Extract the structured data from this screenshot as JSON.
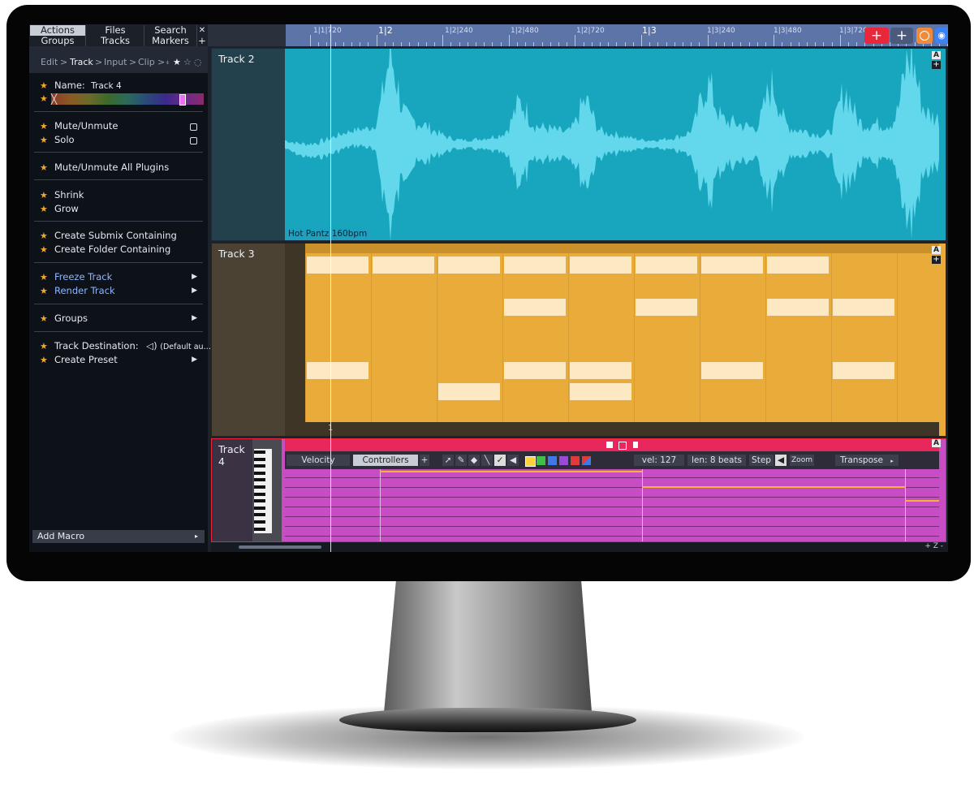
{
  "tabs": {
    "actions": "Actions",
    "files": "Files",
    "search": "Search",
    "groups": "Groups",
    "tracks": "Tracks",
    "markers": "Markers",
    "close": "✕",
    "add": "+"
  },
  "breadcrumb": {
    "edit": "Edit",
    "track": "Track",
    "input": "Input",
    "clip": "Clip",
    "sep": ">"
  },
  "menu": {
    "name_label": "Name:",
    "name_value": "Track 4",
    "mute": "Mute/Unmute",
    "solo": "Solo",
    "mute_plugins": "Mute/Unmute All Plugins",
    "shrink": "Shrink",
    "grow": "Grow",
    "create_submix": "Create Submix Containing",
    "create_folder": "Create Folder Containing",
    "freeze": "Freeze Track",
    "render": "Render Track",
    "groups": "Groups",
    "destination_label": "Track Destination:",
    "destination_value": "(Default au…",
    "create_preset": "Create Preset",
    "add_macro": "Add Macro"
  },
  "ruler": {
    "labels": [
      "1|1|720",
      "1|2",
      "1|2|240",
      "1|2|480",
      "1|2|720",
      "1|3",
      "1|3|240",
      "1|3|480",
      "1|3|720"
    ]
  },
  "tracks": {
    "track2": {
      "name": "Track 2",
      "clip_label": "Hot Pantz 160bpm",
      "color": "#17a6bd"
    },
    "track3": {
      "name": "Track 3",
      "bar_number": "1",
      "color": "#e9ab3a"
    },
    "track4": {
      "name": "Track 4",
      "color": "#c84cc4"
    }
  },
  "midi_toolbar": {
    "velocity": "Velocity",
    "controllers": "Controllers",
    "plus": "+",
    "vel": "vel: 127",
    "len": "len: 8 beats",
    "step": "Step",
    "zoom": "Zoom",
    "transpose": "Transpose"
  },
  "clip_badge": "A",
  "footer_controls": "+ Z -",
  "colors": {
    "accent_red": "#e8283a",
    "star": "#f0a82a",
    "ruler": "#5c74a8",
    "playhead": "#ffffff"
  },
  "icons": [
    "close-icon",
    "plus-icon",
    "star-icon",
    "checkbox-icon",
    "chevron-right-icon",
    "speaker-icon",
    "eye-icon",
    "record-icon",
    "piano-keys-icon",
    "pointer-icon",
    "pencil-icon",
    "eraser-icon",
    "line-icon",
    "brush-icon",
    "volume-icon"
  ]
}
